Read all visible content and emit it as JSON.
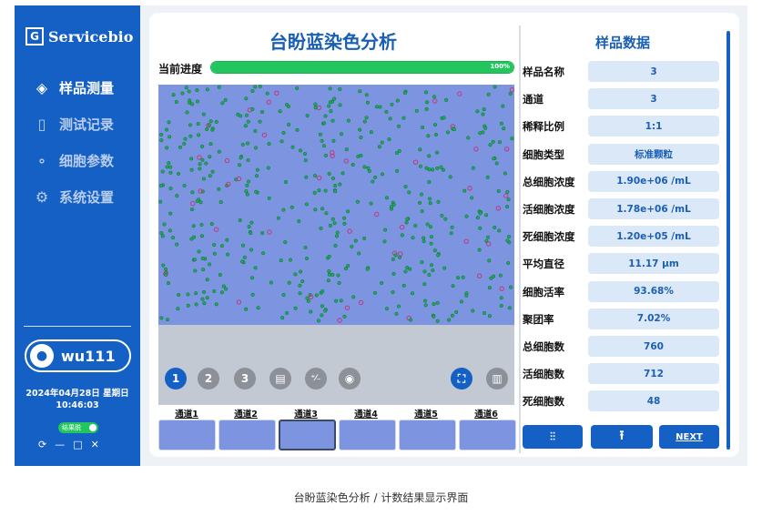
{
  "sidebar": {
    "logo_mark": "G",
    "logo_text": "Servicebio",
    "nav": [
      {
        "label": "样品测量",
        "icon": "diamond-icon",
        "glyph": "◈",
        "active": true
      },
      {
        "label": "测试记录",
        "icon": "bar-chart-icon",
        "glyph": "▯",
        "active": false
      },
      {
        "label": "细胞参数",
        "icon": "nodes-icon",
        "glyph": "∘",
        "active": false
      },
      {
        "label": "系统设置",
        "icon": "gear-icon",
        "glyph": "⚙",
        "active": false
      }
    ],
    "user": "wu111",
    "user_icon": "user-icon",
    "date": "2024年04月28日 星期日",
    "time": "10:46:03",
    "toggle_label": "结果脱",
    "window_controls": [
      "⟳",
      "—",
      "□",
      "✕"
    ]
  },
  "main": {
    "title": "台盼蓝染色分析",
    "progress_label": "当前进度",
    "progress_value": 1.0,
    "progress_text": "100%",
    "controls": [
      {
        "label": "1",
        "state": "active"
      },
      {
        "label": "2",
        "state": "gray"
      },
      {
        "label": "3",
        "state": "gray"
      },
      {
        "label": "▤",
        "icon": "list-icon",
        "state": "gray"
      },
      {
        "label": "⁺⁄₋",
        "icon": "plus-minus-icon",
        "state": "gray"
      },
      {
        "label": "◉",
        "icon": "eye-icon",
        "state": "gray"
      },
      {
        "label": "⛶",
        "icon": "focus-icon",
        "state": "active"
      },
      {
        "label": "▥",
        "icon": "bars-icon",
        "state": "gray"
      }
    ],
    "channels": [
      "通道1",
      "通道2",
      "通道3",
      "通道4",
      "通道5",
      "通道6"
    ],
    "selected_channel": 2
  },
  "panel": {
    "title": "样品数据",
    "rows": [
      {
        "label": "样品名称",
        "value": "3"
      },
      {
        "label": "通道",
        "value": "3"
      },
      {
        "label": "稀释比例",
        "value": "1:1"
      },
      {
        "label": "细胞类型",
        "value": "标准颗粒"
      },
      {
        "label": "总细胞浓度",
        "value": "1.90e+06 /mL"
      },
      {
        "label": "活细胞浓度",
        "value": "1.78e+06 /mL"
      },
      {
        "label": "死细胞浓度",
        "value": "1.20e+05 /mL"
      },
      {
        "label": "平均直径",
        "value": "11.17 μm"
      },
      {
        "label": "细胞活率",
        "value": "93.68%"
      },
      {
        "label": "聚团率",
        "value": "7.02%"
      },
      {
        "label": "总细胞数",
        "value": "760"
      },
      {
        "label": "活细胞数",
        "value": "712"
      },
      {
        "label": "死细胞数",
        "value": "48"
      }
    ],
    "actions": [
      {
        "label": "⫶⫶",
        "icon": "adjust-icon"
      },
      {
        "label": "⭱",
        "icon": "upload-icon"
      },
      {
        "label": "NEXT",
        "icon": "next-arrow-icon"
      }
    ]
  },
  "caption": "台盼蓝染色分析 / 计数结果显示界面",
  "colors": {
    "primary": "#1560c4",
    "progress": "#22c55e",
    "live_cell": "#1fa85a",
    "dead_cell": "#c0377e",
    "field": "#7d95e0"
  }
}
